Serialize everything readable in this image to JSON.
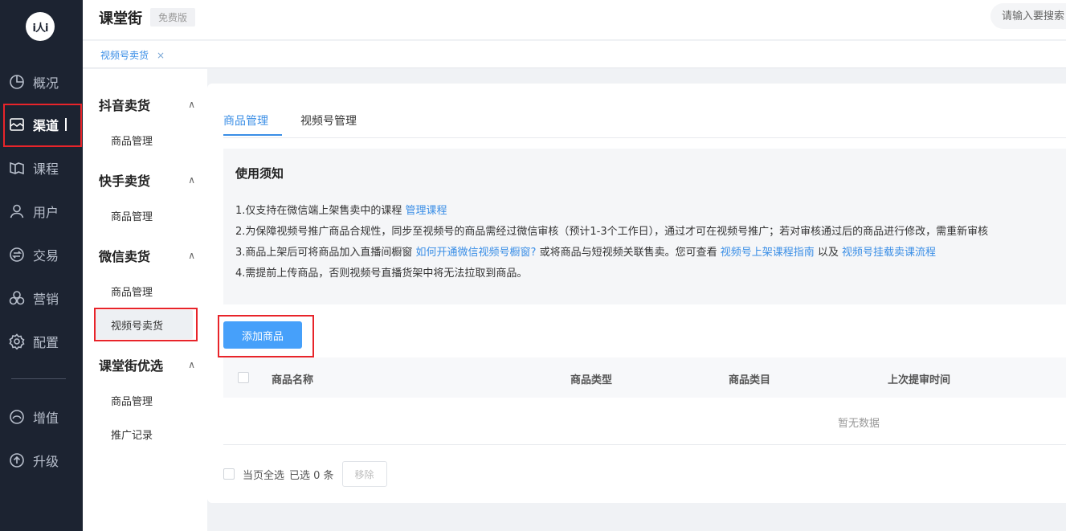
{
  "logo": {
    "text": "i人i"
  },
  "nav": {
    "items": [
      {
        "label": "概况",
        "icon": "pie-chart-icon"
      },
      {
        "label": "渠道",
        "icon": "store-icon",
        "active": true
      },
      {
        "label": "课程",
        "icon": "book-icon"
      },
      {
        "label": "用户",
        "icon": "user-icon"
      },
      {
        "label": "交易",
        "icon": "exchange-icon"
      },
      {
        "label": "营销",
        "icon": "marketing-icon"
      },
      {
        "label": "配置",
        "icon": "gear-icon"
      },
      {
        "label": "增值",
        "icon": "value-added-icon"
      },
      {
        "label": "升级",
        "icon": "upgrade-icon"
      }
    ]
  },
  "header": {
    "brand": "课堂街",
    "badge": "免费版",
    "search_placeholder": "请输入要搜索"
  },
  "tabbar": {
    "tab_label": "视频号卖货",
    "close_glyph": "×"
  },
  "subnav": {
    "groups": [
      {
        "title": "抖音卖货",
        "items": [
          "商品管理"
        ]
      },
      {
        "title": "快手卖货",
        "items": [
          "商品管理"
        ]
      },
      {
        "title": "微信卖货",
        "items": [
          "商品管理",
          "视频号卖货"
        ]
      },
      {
        "title": "课堂街优选",
        "items": [
          "商品管理",
          "推广记录"
        ]
      }
    ],
    "chevron_glyph": "∧"
  },
  "content": {
    "tabs": [
      "商品管理",
      "视频号管理"
    ],
    "notice": {
      "title": "使用须知",
      "line1_text": "1.仅支持在微信端上架售卖中的课程 ",
      "line1_link": "管理课程",
      "line2_text": "2.为保障视频号推广商品合规性，同步至视频号的商品需经过微信审核（预计1-3个工作日），通过才可在视频号推广；若对审核通过后的商品进行修改，需重新审核",
      "line3_text_a": "3.商品上架后可将商品加入直播间橱窗 ",
      "line3_link_a": "如何开通微信视频号橱窗?",
      "line3_text_b": " 或将商品与短视频关联售卖。您可查看 ",
      "line3_link_b": "视频号上架课程指南",
      "line3_text_c": " 以及 ",
      "line3_link_c": "视频号挂载卖课流程",
      "line4_text": "4.需提前上传商品，否则视频号直播货架中将无法拉取到商品。"
    },
    "add_button": "添加商品",
    "table": {
      "columns": [
        "商品名称",
        "商品类型",
        "商品类目",
        "上次提审时间"
      ],
      "empty_text": "暂无数据"
    },
    "footer": {
      "select_all_label": "当页全选",
      "selected_text": "已选 0 条",
      "remove_button": "移除"
    }
  },
  "colors": {
    "nav_bg": "#1c2331",
    "accent": "#3a8ee6",
    "button_blue": "#46a0fa",
    "highlight_red": "#e8242a"
  }
}
